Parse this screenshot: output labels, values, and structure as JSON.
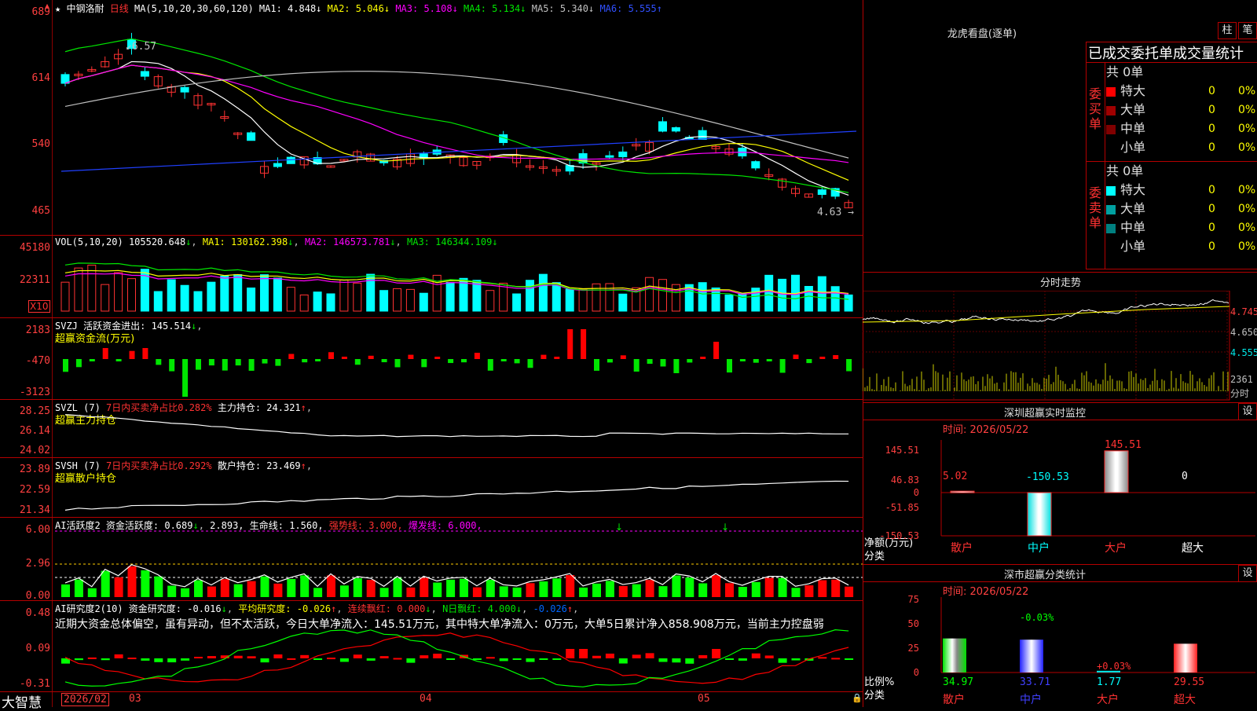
{
  "stock": {
    "star": "★",
    "name": "中钢洛耐",
    "period": "日线",
    "ma_params": "MA(5,10,20,30,60,120)",
    "ma_items": [
      {
        "label": "MA1:",
        "value": "4.848",
        "arrow": "↓",
        "color": "#ffffff"
      },
      {
        "label": "MA2:",
        "value": "5.046",
        "arrow": "↓",
        "color": "#ffff00"
      },
      {
        "label": "MA3:",
        "value": "5.108",
        "arrow": "↓",
        "color": "#ff00ff"
      },
      {
        "label": "MA4:",
        "value": "5.134",
        "arrow": "↓",
        "color": "#00e600"
      },
      {
        "label": "MA5:",
        "value": "5.340",
        "arrow": "↓",
        "color": "#c0c0c0"
      },
      {
        "label": "MA6:",
        "value": "5.555",
        "arrow": "↑",
        "color": "#3050ff"
      }
    ],
    "ticks": [
      "689",
      "614",
      "540",
      "465"
    ],
    "high_label": "6.57",
    "low_label": "4.63"
  },
  "vol": {
    "legend": "VOL(5,10,20)",
    "value": "105520.648",
    "ma1": "MA1: 130162.398",
    "ma2": "MA2: 146573.781",
    "ma3": "MA3: 146344.109",
    "ticks": [
      "45180",
      "22311"
    ],
    "unit": "X10"
  },
  "svzj": {
    "legend": "SVZJ  活跃资金进出: 145.514",
    "sub": "超赢资金流(万元)",
    "ticks": [
      "2183",
      "-470",
      "-3123"
    ]
  },
  "svzl": {
    "legend_a": "SVZL (7)",
    "legend_b": "7日内买卖净占比0.282%",
    "legend_c": "主力持仓: 24.321",
    "sub": "超赢主力持仓",
    "ticks": [
      "28.25",
      "26.14",
      "24.02"
    ]
  },
  "svsh": {
    "legend_a": "SVSH (7)",
    "legend_b": "7日内买卖净占比0.292%",
    "legend_c": "散户持仓: 23.469",
    "sub": "超赢散户持仓",
    "ticks": [
      "23.89",
      "22.59",
      "21.34"
    ]
  },
  "ai1": {
    "legend_a": "AI活跃度2 资金活跃度: 0.689",
    "legend_b": "2.893,",
    "legend_c": "生命线: 1.560,",
    "legend_d": "强势线: 3.000,",
    "legend_e": "爆发线: 6.000,",
    "ticks": [
      "6.00",
      "2.96",
      "0.00"
    ]
  },
  "ai2": {
    "legend_a": "AI研究度2(10) 资金研究度: -0.016",
    "legend_b": "平均研究度: -0.026",
    "legend_c": "连续飘红: 0.000",
    "legend_d": "N日飘红: 4.000",
    "legend_e": "-0.026",
    "comment": "近期大资金总体偏空，虽有异动，但不太活跃，今日大单净流入：145.51万元，其中特大单净流入：0万元，大单5日累计净入858.908万元，当前主力控盘弱",
    "ticks": [
      "0.48",
      "0.09",
      "-0.31"
    ]
  },
  "dates": {
    "brand": "大智慧",
    "d1": "2026/02",
    "d2": "03",
    "d3": "04",
    "d4": "05"
  },
  "right": {
    "dragon_title": "龙虎看盘(逐单)",
    "btn_bar": "柱",
    "btn_pen": "笔",
    "stats_title": "已成交委托单成交量统计",
    "buy_total": "共 0单",
    "sell_total": "共 0单",
    "buy_label": "委买单",
    "sell_label": "委卖单",
    "buy_rows": [
      {
        "label": "特大",
        "v1": "0",
        "v2": "0%",
        "color": "#ff0000"
      },
      {
        "label": "大单",
        "v1": "0",
        "v2": "0%",
        "color": "#a00000"
      },
      {
        "label": "中单",
        "v1": "0",
        "v2": "0%",
        "color": "#800000"
      },
      {
        "label": "小单",
        "v1": "0",
        "v2": "0%",
        "color": "#000000"
      }
    ],
    "sell_rows": [
      {
        "label": "特大",
        "v1": "0",
        "v2": "0%",
        "color": "#00ffff"
      },
      {
        "label": "大单",
        "v1": "0",
        "v2": "0%",
        "color": "#00a0a0"
      },
      {
        "label": "中单",
        "v1": "0",
        "v2": "0%",
        "color": "#008080"
      },
      {
        "label": "小单",
        "v1": "0",
        "v2": "0%",
        "color": "#000000"
      }
    ],
    "intraday_title": "分时走势",
    "intraday_ticks": [
      "4.745",
      "4.650",
      "4.555"
    ],
    "intraday_vol": "2361",
    "intraday_unit": "分时",
    "sz_title": "深圳超赢实时监控",
    "sz_btn": "设",
    "sz_time": "时间: 2026/05/22",
    "sz_ticks": [
      "145.51",
      "46.83",
      "0",
      "-51.85",
      "-150.53"
    ],
    "sz_ylabel": "净额(万元)",
    "sz_xlabel": "分类",
    "sz_cats": [
      "散户",
      "中户",
      "大户",
      "超大"
    ],
    "sz_vals": [
      "5.02",
      "-150.53",
      "145.51",
      "0"
    ],
    "cls_title": "深市超赢分类统计",
    "cls_btn": "设",
    "cls_time": "时间: 2026/05/22",
    "cls_ticks": [
      "75",
      "50",
      "25",
      "0"
    ],
    "cls_ylabel": "比例%",
    "cls_xlabel": "分类",
    "cls_cats": [
      "散户",
      "中户",
      "大户",
      "超大"
    ],
    "cls_vals": [
      "34.97",
      "33.71",
      "1.77",
      "29.55"
    ],
    "cls_deltas": [
      "-0.03%",
      "+0.03%"
    ]
  },
  "chart_data": {
    "type": "bar",
    "title": "中钢洛耐 日线",
    "categories": [
      "散户",
      "中户",
      "大户",
      "超大"
    ],
    "series": [
      {
        "name": "净额(万元)",
        "values": [
          5.02,
          -150.53,
          145.51,
          0
        ]
      },
      {
        "name": "比例%",
        "values": [
          34.97,
          33.71,
          1.77,
          29.55
        ]
      }
    ],
    "price_range": [
      4.63,
      6.89
    ]
  }
}
